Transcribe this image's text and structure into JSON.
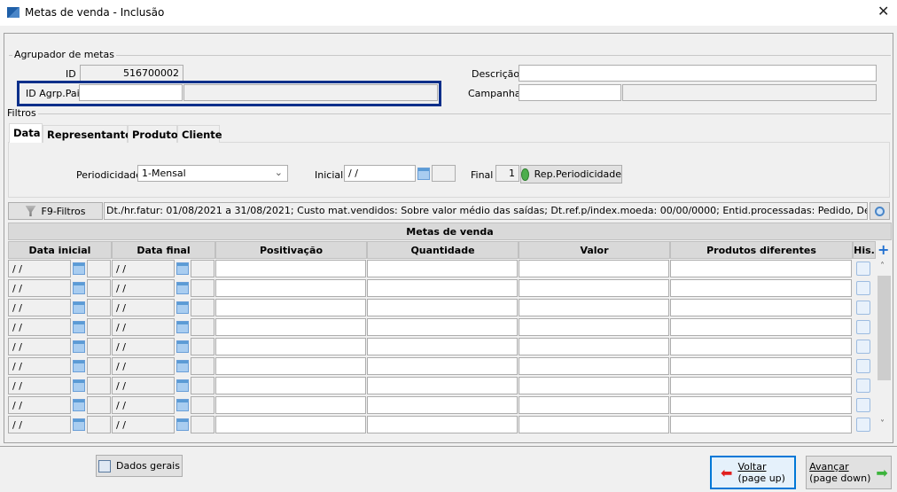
{
  "window": {
    "title": "Metas de venda - Inclusão",
    "close": "✕"
  },
  "agrupador": {
    "legend": "Agrupador de metas",
    "id_label": "ID",
    "id_value": "516700002",
    "pai_label": "ID Agrp.Pai",
    "pai_value": "",
    "descricao_label": "Descrição",
    "descricao_value": "",
    "campanha_label": "Campanha",
    "campanha_value": ""
  },
  "filtros": {
    "legend": "Filtros",
    "tabs": [
      "Data",
      "Representante",
      "Produto",
      "Cliente"
    ],
    "periodicidade_label": "Periodicidade",
    "periodicidade_value": "1-Mensal",
    "inicial_label": "Inicial",
    "inicial_value": " /  /",
    "final_label": "Final",
    "final_value": "1",
    "rep_button": "Rep.Periodicidade",
    "f9_button": "F9-Filtros",
    "summary": "Dt./hr.fatur: 01/08/2021 a 31/08/2021; Custo mat.vendidos: Sobre valor médio das saídas; Dt.ref.p/index.moeda: 00/00/0000; Entid.processadas: Pedido, Devolução,"
  },
  "grid": {
    "title": "Metas de venda",
    "columns": [
      "Data inicial",
      "Data final",
      "Positivação",
      "Quantidade",
      "Valor",
      "Produtos diferentes",
      "His."
    ],
    "add": "+",
    "rows": [
      {
        "ini": " /  /",
        "fim": " /  /"
      },
      {
        "ini": " /  /",
        "fim": " /  /"
      },
      {
        "ini": " /  /",
        "fim": " /  /"
      },
      {
        "ini": " /  /",
        "fim": " /  /"
      },
      {
        "ini": " /  /",
        "fim": " /  /"
      },
      {
        "ini": " /  /",
        "fim": " /  /"
      },
      {
        "ini": " /  /",
        "fim": " /  /"
      },
      {
        "ini": " /  /",
        "fim": " /  /"
      },
      {
        "ini": " /  /",
        "fim": " /  /"
      }
    ]
  },
  "footer": {
    "dados_gerais": "Dados gerais",
    "voltar": "Voltar",
    "voltar_sub": "(page up)",
    "avancar": "Avançar",
    "avancar_sub": "(page down)"
  }
}
